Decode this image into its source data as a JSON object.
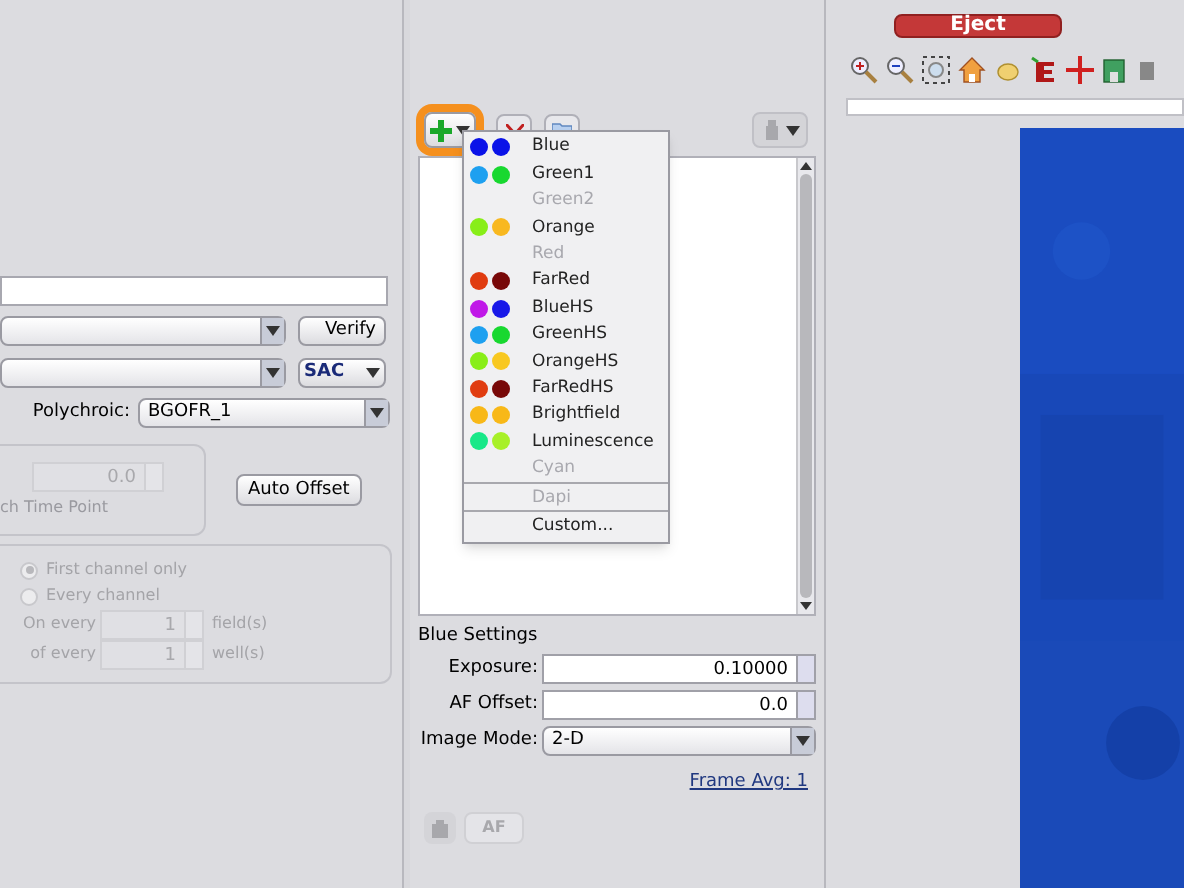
{
  "left_panel": {
    "verify_button": "Verify",
    "sac_select": "SAC",
    "polychroic_label": "Polychroic:",
    "polychroic_value": "BGOFR_1",
    "offset_value": "0.0",
    "time_point_label": "ch Time Point",
    "auto_offset_button": "Auto Offset",
    "radios": [
      {
        "label": "First channel only",
        "selected": true
      },
      {
        "label": "Every channel",
        "selected": false
      }
    ],
    "every_rows": [
      {
        "label": "On every",
        "value": "1",
        "unit": "field(s)"
      },
      {
        "label": "of every",
        "value": "1",
        "unit": "well(s)"
      }
    ]
  },
  "channel_menu": {
    "items": [
      {
        "label": "Blue",
        "disabled": false,
        "dots": [
          {
            "color": "#0a12e8"
          },
          {
            "color": "#0a12e8"
          }
        ],
        "separator_before": false
      },
      {
        "label": "Green1",
        "disabled": false,
        "dots": [
          {
            "color": "#1ea0f0"
          },
          {
            "color": "#18d830"
          }
        ],
        "separator_before": false
      },
      {
        "label": "Green2",
        "disabled": true,
        "separator_before": false
      },
      {
        "label": "Orange",
        "disabled": false,
        "dots": [
          {
            "color": "#88ee18"
          },
          {
            "color": "#f8b820"
          }
        ],
        "separator_before": false
      },
      {
        "label": "Red",
        "disabled": true,
        "separator_before": false
      },
      {
        "label": "FarRed",
        "disabled": false,
        "dots": [
          {
            "color": "#e03c10"
          },
          {
            "color": "#780808"
          }
        ],
        "separator_before": false
      },
      {
        "label": "BlueHS",
        "disabled": false,
        "dots": [
          {
            "color": "#c018e8"
          },
          {
            "color": "#1818e8"
          }
        ],
        "separator_before": false
      },
      {
        "label": "GreenHS",
        "disabled": false,
        "dots": [
          {
            "color": "#1ea0f0"
          },
          {
            "color": "#18d830"
          }
        ],
        "separator_before": false
      },
      {
        "label": "OrangeHS",
        "disabled": false,
        "dots": [
          {
            "color": "#88ee18"
          },
          {
            "color": "#f8c820"
          }
        ],
        "separator_before": false
      },
      {
        "label": "FarRedHS",
        "disabled": false,
        "dots": [
          {
            "color": "#e03c10"
          },
          {
            "color": "#780808"
          }
        ],
        "separator_before": false
      },
      {
        "label": "Brightfield",
        "disabled": false,
        "dots": [
          {
            "color": "#f8b818"
          },
          {
            "color": "#f8b818"
          }
        ],
        "separator_before": false
      },
      {
        "label": "Luminescence",
        "disabled": false,
        "dots": [
          {
            "color": "#18e888"
          },
          {
            "color": "#a8f028"
          }
        ],
        "separator_before": false
      },
      {
        "label": "Cyan",
        "disabled": true,
        "separator_before": false
      },
      {
        "label": "Dapi",
        "disabled": true,
        "separator_before": true
      },
      {
        "label": "Custom...",
        "disabled": false,
        "separator_before": true
      }
    ]
  },
  "settings": {
    "title": "Blue Settings",
    "exposure_label": "Exposure:",
    "exposure_value": "0.10000",
    "af_offset_label": "AF Offset:",
    "af_offset_value": "0.0",
    "image_mode_label": "Image Mode:",
    "image_mode_value": "2-D",
    "frame_avg_link": "Frame Avg: 1",
    "af_button": "AF"
  },
  "viewer": {
    "eject_button": "Eject"
  }
}
